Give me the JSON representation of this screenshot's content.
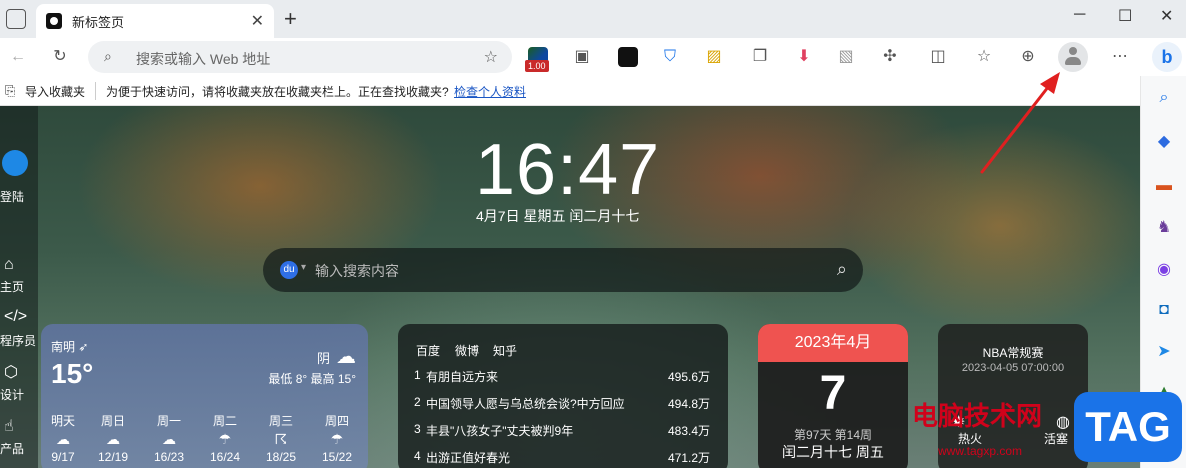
{
  "tab": {
    "title": "新标签页"
  },
  "address_bar": {
    "placeholder": "搜索或输入 Web 地址"
  },
  "extension_badge": "1.00",
  "favorites_bar": {
    "import_label": "导入收藏夹",
    "hint": "为便于快速访问，请将收藏夹放在收藏夹栏上。正在查找收藏夹?",
    "link": "检查个人资料"
  },
  "left_rail": {
    "login": "登陆",
    "items": [
      "主页",
      "程序员",
      "设计",
      "产品"
    ]
  },
  "clock": {
    "time": "16:47",
    "date": "4月7日  星期五  闰二月十七"
  },
  "search": {
    "placeholder": "输入搜索内容"
  },
  "weather": {
    "city": "南明",
    "temp": "15°",
    "condition": "阴",
    "range": "最低 8° 最高 15°",
    "forecast": [
      {
        "day": "明天",
        "range": "9/17"
      },
      {
        "day": "周日",
        "range": "12/19"
      },
      {
        "day": "周一",
        "range": "16/23"
      },
      {
        "day": "周二",
        "range": "16/24"
      },
      {
        "day": "周三",
        "range": "18/25"
      },
      {
        "day": "周四",
        "range": "15/22"
      }
    ]
  },
  "hot": {
    "tabs": [
      "百度",
      "微博",
      "知乎"
    ],
    "items": [
      {
        "n": "1",
        "title": "有朋自远方来",
        "value": "495.6万"
      },
      {
        "n": "2",
        "title": "中国领导人愿与乌总统会谈?中方回应",
        "value": "494.8万"
      },
      {
        "n": "3",
        "title": "丰县\"八孩女子\"丈夫被判9年",
        "value": "483.4万"
      },
      {
        "n": "4",
        "title": "出游正值好春光",
        "value": "471.2万"
      }
    ]
  },
  "calendar": {
    "month": "2023年4月",
    "day": "7",
    "week": "第97天 第14周",
    "lunar": "闰二月十七 周五"
  },
  "nba": {
    "title": "NBA常规赛",
    "time": "2023-04-05 07:00:00",
    "home": "热火",
    "away": "活塞"
  },
  "watermark": {
    "text": "电脑技术网",
    "url": "www.tagxp.com",
    "tag": "TAG"
  },
  "colors": {
    "arrow": "#e02020",
    "calendar_header": "#ef5350",
    "link": "#1a56c4"
  }
}
